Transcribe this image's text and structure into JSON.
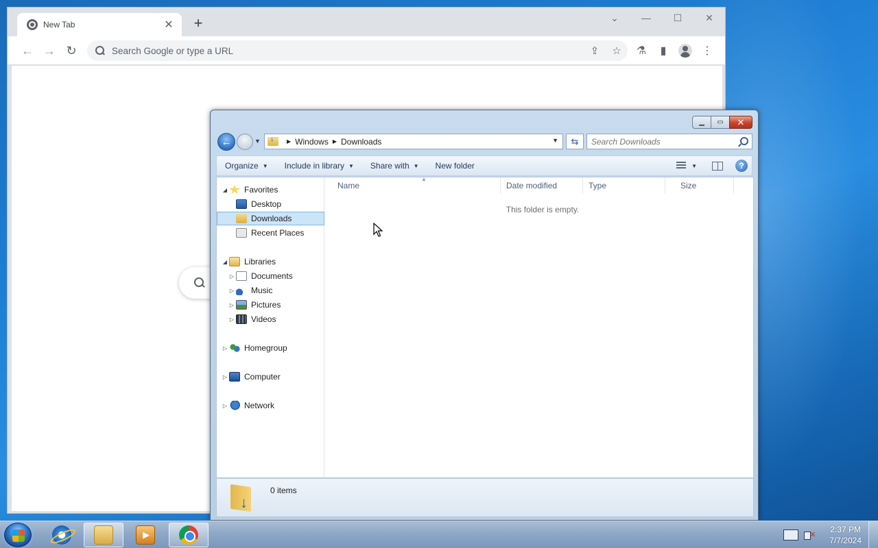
{
  "browser": {
    "tab_title": "New Tab",
    "tab_close": "✕",
    "new_tab": "+",
    "controls": {
      "minimize": "—",
      "maximize": "☐",
      "close": "✕",
      "tabsearch": "⌄"
    },
    "nav": {
      "back": "←",
      "forward": "→",
      "reload": "↻"
    },
    "omnibox_placeholder": "Search Google or type a URL",
    "omnibox_icons": {
      "share": "⇪",
      "bookmark": "☆"
    },
    "toolbar_icons": {
      "extension": "⚗",
      "sidepanel": "▮",
      "menu": "⋮"
    }
  },
  "explorer": {
    "controls": {
      "minimize": "▁",
      "maximize": "▭",
      "close": "✕"
    },
    "breadcrumb": [
      "Windows",
      "Downloads"
    ],
    "back_glyph": "←",
    "refresh_glyph": "⇆",
    "search_placeholder": "Search Downloads",
    "commands": [
      {
        "label": "Organize",
        "dropdown": true
      },
      {
        "label": "Include in library",
        "dropdown": true
      },
      {
        "label": "Share with",
        "dropdown": true
      },
      {
        "label": "New folder",
        "dropdown": false
      }
    ],
    "help": "?",
    "nav": {
      "favorites": "Favorites",
      "desktop": "Desktop",
      "downloads": "Downloads",
      "recent_places": "Recent Places",
      "libraries": "Libraries",
      "documents": "Documents",
      "music": "Music",
      "pictures": "Pictures",
      "videos": "Videos",
      "homegroup": "Homegroup",
      "computer": "Computer",
      "network": "Network"
    },
    "columns": [
      "Name",
      "Date modified",
      "Type",
      "Size"
    ],
    "empty_message": "This folder is empty.",
    "item_count": "0 items"
  },
  "taskbar": {
    "pinned": [
      {
        "name": "internet-explorer",
        "active": false
      },
      {
        "name": "windows-explorer",
        "active": true
      },
      {
        "name": "media-player",
        "active": false
      },
      {
        "name": "google-chrome",
        "active": true
      }
    ],
    "clock_time": "2:37 PM",
    "clock_date": "7/7/2024"
  }
}
